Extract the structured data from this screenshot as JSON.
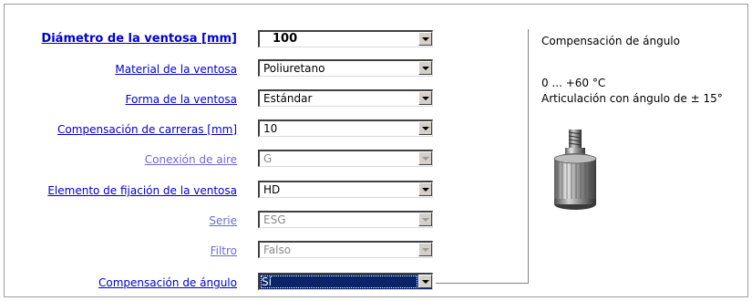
{
  "form": {
    "rows": [
      {
        "label": "Diámetro de la ventosa [mm]",
        "value": "100",
        "enabled": true,
        "emphasis": true
      },
      {
        "label": "Material de la ventosa",
        "value": "Poliuretano",
        "enabled": true
      },
      {
        "label": "Forma de la ventosa",
        "value": "Estándar",
        "enabled": true
      },
      {
        "label": "Compensación de carreras [mm]",
        "value": "10",
        "enabled": true
      },
      {
        "label": "Conexión de aire",
        "value": "G",
        "enabled": false
      },
      {
        "label": "Elemento de fijación de la ventosa",
        "value": "HD",
        "enabled": true
      },
      {
        "label": "Serie",
        "value": "ESG",
        "enabled": false
      },
      {
        "label": "Filtro",
        "value": "Falso",
        "enabled": false
      },
      {
        "label": "Compensación de ángulo",
        "value": "Sí",
        "enabled": true,
        "selected": true
      }
    ]
  },
  "info": {
    "title": "Compensación de ángulo",
    "temperature": "0 ... +60 °C",
    "articulation": "Articulación con ángulo de ± 15°",
    "image_icon": "angle-compensator-part-image"
  },
  "colors": {
    "link": "#0000cc",
    "link_disabled": "#6b6bd6",
    "highlight": "#0a246a"
  }
}
